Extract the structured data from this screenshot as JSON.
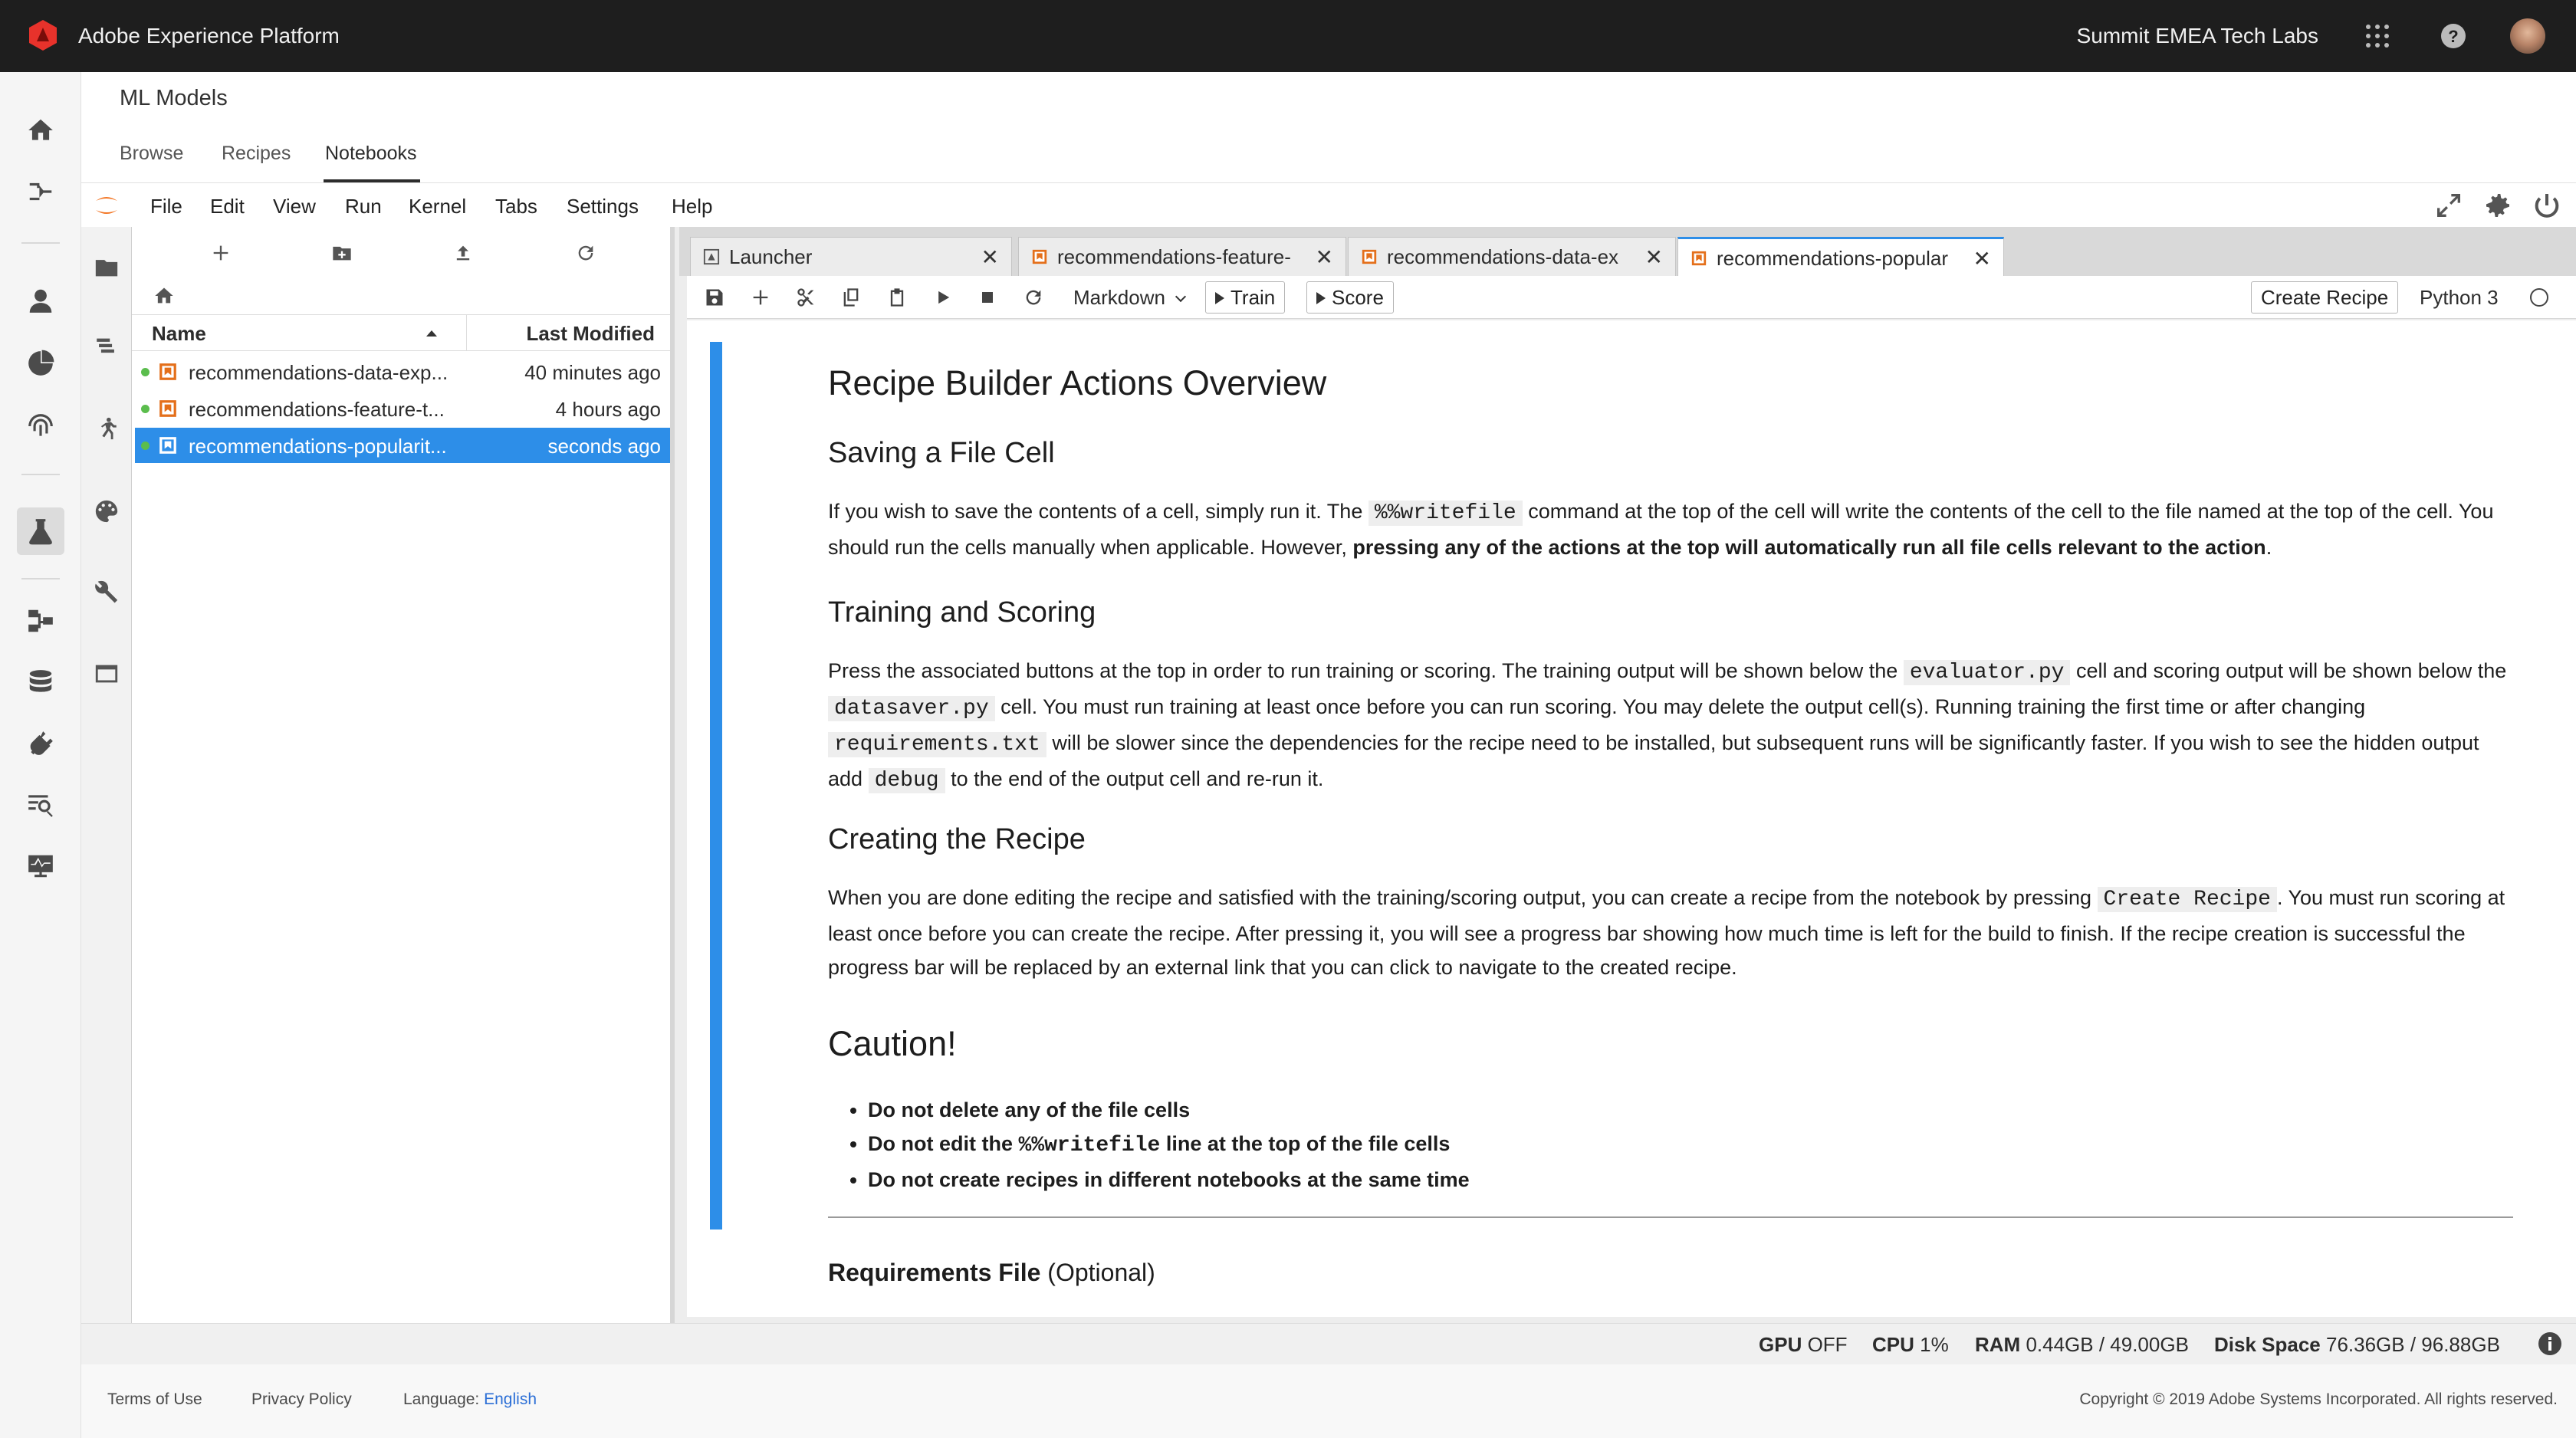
{
  "topbar": {
    "brand": "Adobe Experience Platform",
    "org": "Summit EMEA Tech Labs"
  },
  "header": {
    "title": "ML Models",
    "tabs": [
      "Browse",
      "Recipes",
      "Notebooks"
    ],
    "active_tab": "Notebooks"
  },
  "menu": [
    "File",
    "Edit",
    "View",
    "Run",
    "Kernel",
    "Tabs",
    "Settings",
    "Help"
  ],
  "file_browser": {
    "columns": {
      "name": "Name",
      "modified": "Last Modified"
    },
    "files": [
      {
        "name": "recommendations-data-exp...",
        "modified": "40 minutes ago"
      },
      {
        "name": "recommendations-feature-t...",
        "modified": "4 hours ago"
      },
      {
        "name": "recommendations-popularit...",
        "modified": "seconds ago"
      }
    ]
  },
  "tabs": [
    {
      "label": "Launcher"
    },
    {
      "label": "recommendations-feature-"
    },
    {
      "label": "recommendations-data-ex"
    },
    {
      "label": "recommendations-popular"
    }
  ],
  "toolbar": {
    "cell_type": "Markdown",
    "train": "Train",
    "score": "Score",
    "create_recipe": "Create Recipe",
    "kernel": "Python 3"
  },
  "notebook": {
    "h1": "Recipe Builder Actions Overview",
    "s1_title": "Saving a File Cell",
    "s1_a": "If you wish to save the contents of a cell, simply run it. The",
    "s1_code": "%%writefile",
    "s1_b": "command at the top of the cell will write the contents of the cell to the file named at the top of the cell. You should run the cells manually when applicable. However,",
    "s1_bold": "pressing any of the actions at the top will automatically run all file cells relevant to the action",
    "s1_c": ".",
    "s2_title": "Training and Scoring",
    "s2_a": "Press the associated buttons at the top in order to run training or scoring. The training output will be shown below the",
    "s2_code1": "evaluator.py",
    "s2_b": "cell and scoring output will be shown below the",
    "s2_code2": "datasaver.py",
    "s2_c": "cell. You must run training at least once before you can run scoring. You may delete the output cell(s). Running training the first time or after changing",
    "s2_code3": "requirements.txt",
    "s2_d": "will be slower since the dependencies for the recipe need to be installed, but subsequent runs will be significantly faster. If you wish to see the hidden output add",
    "s2_code4": "debug",
    "s2_e": "to the end of the output cell and re-run it.",
    "s3_title": "Creating the Recipe",
    "s3_a": "When you are done editing the recipe and satisfied with the training/scoring output, you can create a recipe from the notebook by pressing",
    "s3_code": "Create Recipe",
    "s3_b": ". You must run scoring at least once before you can create the recipe. After pressing it, you will see a progress bar showing how much time is left for the build to finish. If the recipe creation is successful the progress bar will be replaced by an external link that you can click to navigate to the created recipe.",
    "caution_title": "Caution!",
    "c1": "Do not delete any of the file cells",
    "c2a": "Do not edit the",
    "c2code": "%%writefile",
    "c2b": "line at the top of the file cells",
    "c3": "Do not create recipes in different notebooks at the same time",
    "req_title": "Requirements File",
    "req_opt": "(Optional)"
  },
  "status": {
    "gpu_label": "GPU",
    "gpu": "OFF",
    "cpu_label": "CPU",
    "cpu": "1%",
    "ram_label": "RAM",
    "ram": "0.44GB / 49.00GB",
    "disk_label": "Disk Space",
    "disk": "76.36GB / 96.88GB"
  },
  "footer": {
    "terms": "Terms of Use",
    "privacy": "Privacy Policy",
    "language_label": "Language:",
    "language": "English",
    "copyright": "Copyright ©  2019 Adobe Systems Incorporated.  All rights reserved."
  },
  "colors": {
    "accent": "#2d8ee8",
    "adobe_red": "#e8322b",
    "running_dot": "#5bbd4d",
    "notebook_icon": "#e46f1a"
  }
}
